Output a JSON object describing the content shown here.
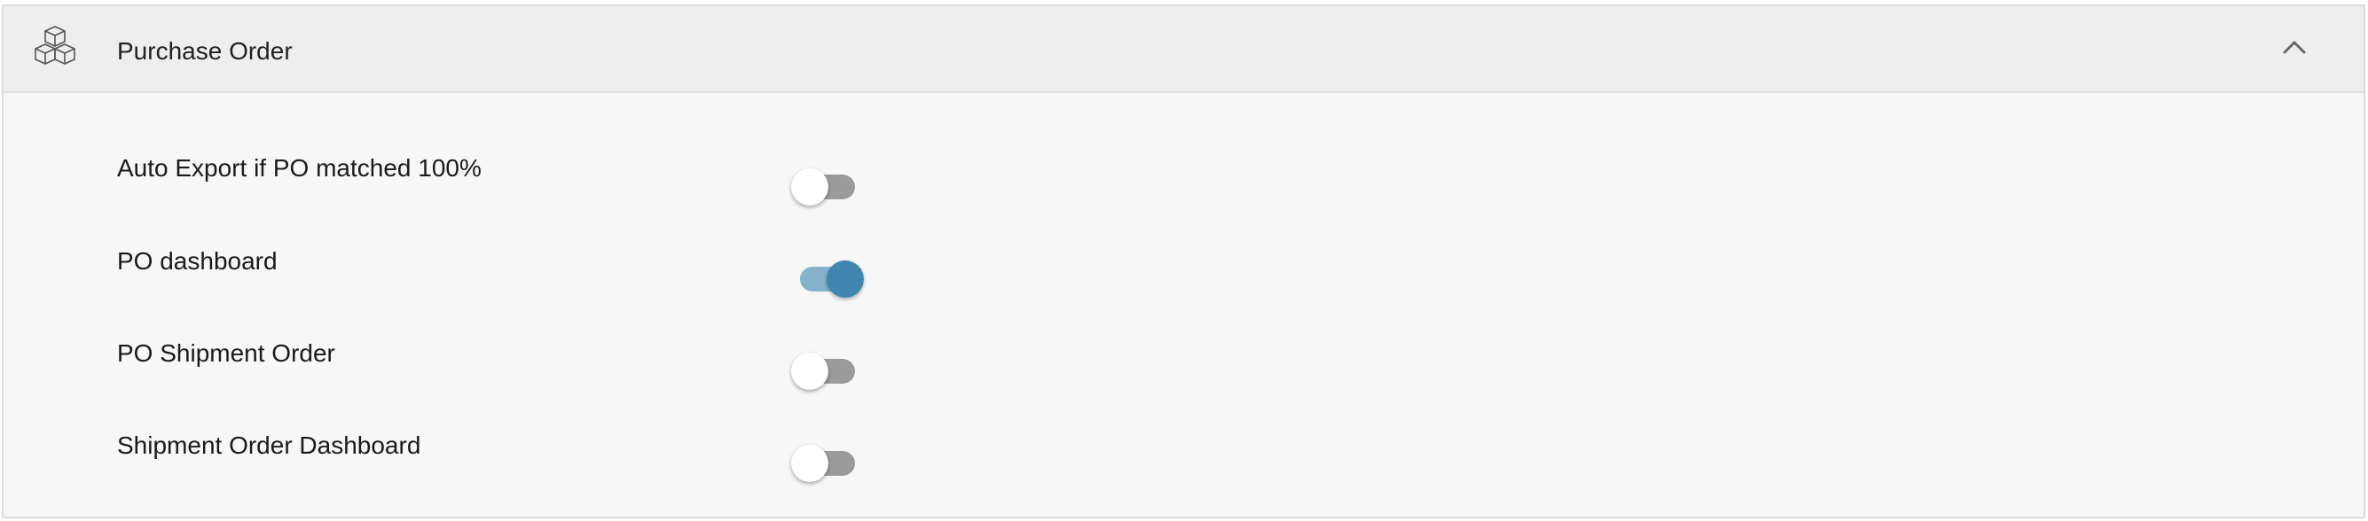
{
  "section": {
    "title": "Purchase Order",
    "icon": "boxes-icon",
    "collapse_icon": "chevron-up-icon",
    "expanded": true
  },
  "settings": [
    {
      "label": "Auto Export if PO matched 100%",
      "enabled": false
    },
    {
      "label": "PO dashboard",
      "enabled": true
    },
    {
      "label": "PO Shipment Order",
      "enabled": false
    },
    {
      "label": "Shipment Order Dashboard",
      "enabled": false
    }
  ],
  "colors": {
    "toggle_on_thumb": "#3f87b0",
    "toggle_on_track": "#86b3cc",
    "toggle_off_track": "#9b9b9b",
    "header_bg": "#eeeeee",
    "panel_bg": "#f7f7f7"
  }
}
